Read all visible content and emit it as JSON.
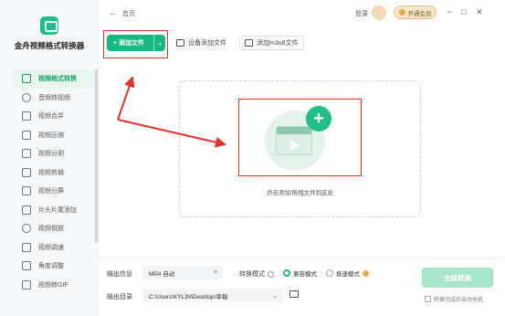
{
  "app": {
    "title": "金舟视频格式转换器"
  },
  "sidebar": {
    "items": [
      {
        "label": "视频格式转换",
        "icon": "convert-icon",
        "active": true
      },
      {
        "label": "音频转视频",
        "icon": "audio-icon"
      },
      {
        "label": "视频合并",
        "icon": "merge-icon"
      },
      {
        "label": "视频压缩",
        "icon": "compress-icon"
      },
      {
        "label": "视频分割",
        "icon": "split-icon"
      },
      {
        "label": "视频剪辑",
        "icon": "edit-icon"
      },
      {
        "label": "视频分屏",
        "icon": "split-screen-icon"
      },
      {
        "label": "片头片尾添加",
        "icon": "intro-outro-icon"
      },
      {
        "label": "视频倒放",
        "icon": "reverse-icon"
      },
      {
        "label": "视频调速",
        "icon": "speed-icon"
      },
      {
        "label": "角度调整",
        "icon": "rotate-icon"
      },
      {
        "label": "视频转GIF",
        "icon": "gif-icon"
      }
    ]
  },
  "titlebar": {
    "back": "←",
    "breadcrumb": "首页",
    "login": "登录",
    "vip": "开通会员",
    "minimize": "−",
    "maximize": "□",
    "close": "✕"
  },
  "toolbar": {
    "add_file": "+ 添加文件",
    "add_dropdown": "⌄",
    "device_add": "设备添加文件",
    "add_m3u8": "添加m3u8文件"
  },
  "dropzone": {
    "hint": "点击添加/拖拽文件到这处",
    "plus": "+"
  },
  "bottom": {
    "output_format_label": "输出信息",
    "output_format_value": "MP4 自动",
    "output_format_arrow": ">",
    "convert_mode_label": "转换模式",
    "mode_compatible": "兼容模式",
    "mode_fast": "极速模式",
    "output_dir_label": "输出目录",
    "output_dir_value": "C:\\Users\\KYLIN\\Desktop\\草稿",
    "output_dir_arrow": "⌄",
    "convert_all": "全部转换",
    "shutdown_label": "转换完成后自动关机"
  },
  "colors": {
    "accent": "#17b982",
    "highlight": "#e4342b"
  }
}
